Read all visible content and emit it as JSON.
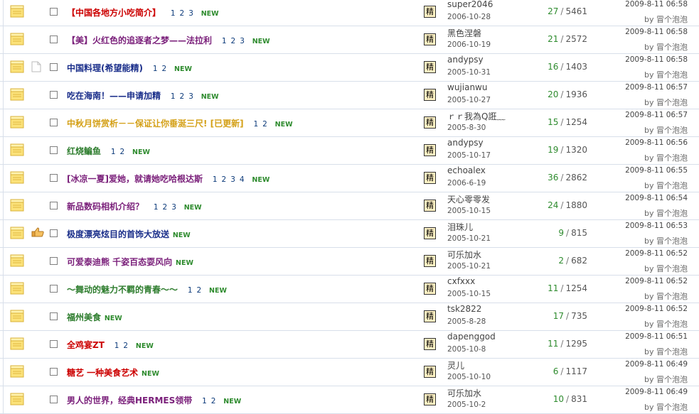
{
  "by_label": "by",
  "threads": [
    {
      "title": "【中国各地方小吃简介】",
      "color": "#cc0000",
      "pages": [
        "1",
        "2",
        "3"
      ],
      "new": "NEW",
      "status": "none",
      "digest": "精",
      "author": "super2046",
      "date": "2006-10-28",
      "replies": "27",
      "views": "5461",
      "last_time": "2009-8-11 06:58",
      "last_user": "冒个泡泡"
    },
    {
      "title": "【美】火红色的追逐者之梦——法拉利",
      "color": "#7a1f7a",
      "pages": [
        "1",
        "2",
        "3"
      ],
      "new": "NEW",
      "status": "none",
      "digest": "精",
      "author": "黑色涅磐",
      "date": "2006-10-19",
      "replies": "21",
      "views": "2572",
      "last_time": "2009-8-11 06:58",
      "last_user": "冒个泡泡"
    },
    {
      "title": "中国料理(希望能精)",
      "color": "#1a2e8a",
      "pages": [
        "1",
        "2"
      ],
      "new": "NEW",
      "status": "page",
      "digest": "精",
      "author": "andypsy",
      "date": "2005-10-31",
      "replies": "16",
      "views": "1403",
      "last_time": "2009-8-11 06:58",
      "last_user": "冒个泡泡"
    },
    {
      "title": "吃在海南！——申请加精",
      "color": "#1a2e8a",
      "pages": [
        "1",
        "2",
        "3"
      ],
      "new": "NEW",
      "status": "none",
      "digest": "精",
      "author": "wujianwu",
      "date": "2005-10-27",
      "replies": "20",
      "views": "1936",
      "last_time": "2009-8-11 06:57",
      "last_user": "冒个泡泡"
    },
    {
      "title": "中秋月饼赏析－－保证让你垂涎三尺! [已更新]",
      "color": "#d4a017",
      "pages": [
        "1",
        "2"
      ],
      "new": "NEW",
      "status": "none",
      "digest": "精",
      "author": "ｒｒ我為Q誑﹏",
      "date": "2005-8-30",
      "replies": "15",
      "views": "1254",
      "last_time": "2009-8-11 06:57",
      "last_user": "冒个泡泡"
    },
    {
      "title": "红烧鳊鱼",
      "color": "#2e7d2e",
      "pages": [
        "1",
        "2"
      ],
      "new": "NEW",
      "status": "none",
      "digest": "精",
      "author": "andypsy",
      "date": "2005-10-17",
      "replies": "19",
      "views": "1320",
      "last_time": "2009-8-11 06:56",
      "last_user": "冒个泡泡"
    },
    {
      "title": "[冰凉一夏]爱她，就请她吃哈根达斯",
      "color": "#7a1f7a",
      "pages": [
        "1",
        "2",
        "3",
        "4"
      ],
      "new": "NEW",
      "status": "none",
      "digest": "精",
      "author": "echoalex",
      "date": "2006-6-19",
      "replies": "36",
      "views": "2862",
      "last_time": "2009-8-11 06:55",
      "last_user": "冒个泡泡"
    },
    {
      "title": "新品数码相机介绍？",
      "color": "#7a1f7a",
      "pages": [
        "1",
        "2",
        "3"
      ],
      "new": "NEW",
      "status": "none",
      "digest": "精",
      "author": "天心零零发",
      "date": "2005-10-15",
      "replies": "24",
      "views": "1880",
      "last_time": "2009-8-11 06:54",
      "last_user": "冒个泡泡"
    },
    {
      "title": "极度漂亮炫目的首饰大放送",
      "color": "#1a2e8a",
      "pages": [],
      "new": "NEW",
      "status": "thumb",
      "digest": "精",
      "author": "泪珠儿",
      "date": "2005-10-21",
      "replies": "9",
      "views": "815",
      "last_time": "2009-8-11 06:53",
      "last_user": "冒个泡泡"
    },
    {
      "title": "可爱泰迪熊  千姿百态耍风向",
      "color": "#7a1f7a",
      "pages": [],
      "new": "NEW",
      "status": "none",
      "digest": "精",
      "author": "可乐加水",
      "date": "2005-10-21",
      "replies": "2",
      "views": "682",
      "last_time": "2009-8-11 06:52",
      "last_user": "冒个泡泡"
    },
    {
      "title": "～舞动的魅力不羁的青春～～",
      "color": "#2e7d2e",
      "pages": [
        "1",
        "2"
      ],
      "new": "NEW",
      "status": "none",
      "digest": "精",
      "author": "cxfxxx",
      "date": "2005-10-15",
      "replies": "11",
      "views": "1254",
      "last_time": "2009-8-11 06:52",
      "last_user": "冒个泡泡"
    },
    {
      "title": "福州美食",
      "color": "#2e7d2e",
      "pages": [],
      "new": "NEW",
      "status": "none",
      "digest": "精",
      "author": "tsk2822",
      "date": "2005-8-28",
      "replies": "17",
      "views": "735",
      "last_time": "2009-8-11 06:52",
      "last_user": "冒个泡泡"
    },
    {
      "title": "全鸡宴ZT",
      "color": "#cc0000",
      "pages": [
        "1",
        "2"
      ],
      "new": "NEW",
      "status": "none",
      "digest": "精",
      "author": "dapenggod",
      "date": "2005-10-8",
      "replies": "11",
      "views": "1295",
      "last_time": "2009-8-11 06:51",
      "last_user": "冒个泡泡"
    },
    {
      "title": "糖艺  一种美食艺术",
      "color": "#cc0000",
      "pages": [],
      "new": "NEW",
      "status": "none",
      "digest": "精",
      "author": "灵儿",
      "date": "2005-10-10",
      "replies": "6",
      "views": "1117",
      "last_time": "2009-8-11 06:49",
      "last_user": "冒个泡泡"
    },
    {
      "title": "男人的世界，经典HERMES领带",
      "color": "#7a1f7a",
      "pages": [
        "1",
        "2"
      ],
      "new": "NEW",
      "status": "none",
      "digest": "精",
      "author": "可乐加水",
      "date": "2005-10-2",
      "replies": "10",
      "views": "831",
      "last_time": "2009-8-11 06:49",
      "last_user": "冒个泡泡"
    }
  ]
}
